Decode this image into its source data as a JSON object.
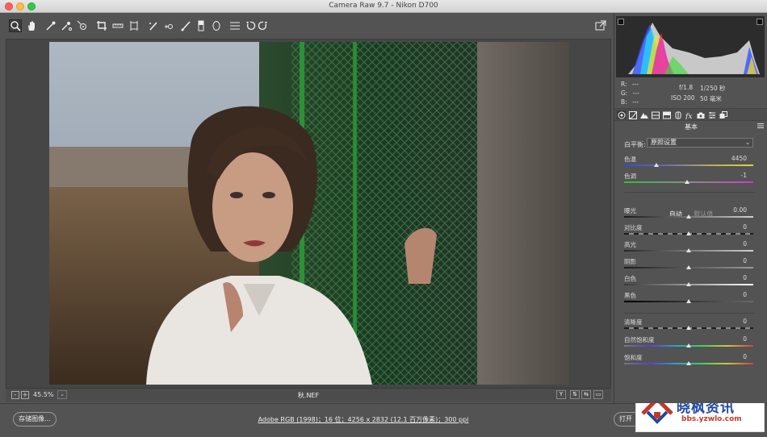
{
  "window": {
    "title": "Camera Raw 9.7 -  Nikon D700"
  },
  "toolbar": {
    "tools": [
      {
        "name": "zoom-tool",
        "icon": "zoom-icon"
      },
      {
        "name": "hand-tool",
        "icon": "hand-icon"
      },
      {
        "name": "white-balance-tool",
        "icon": "eyedropper-icon"
      },
      {
        "name": "color-sampler-tool",
        "icon": "color-sampler-icon"
      },
      {
        "name": "targeted-adjustment-tool",
        "icon": "target-adjust-icon"
      },
      {
        "name": "crop-tool",
        "icon": "crop-icon"
      },
      {
        "name": "straighten-tool",
        "icon": "straighten-icon"
      },
      {
        "name": "transform-tool",
        "icon": "transform-icon"
      },
      {
        "name": "spot-removal-tool",
        "icon": "spot-removal-icon"
      },
      {
        "name": "red-eye-tool",
        "icon": "red-eye-icon"
      },
      {
        "name": "adjustment-brush-tool",
        "icon": "brush-icon"
      },
      {
        "name": "graduated-filter-tool",
        "icon": "graduated-filter-icon"
      },
      {
        "name": "radial-filter-tool",
        "icon": "radial-filter-icon"
      },
      {
        "name": "preferences-tool",
        "icon": "list-icon"
      },
      {
        "name": "rotate-ccw-tool",
        "icon": "rotate-ccw-icon"
      },
      {
        "name": "rotate-cw-tool",
        "icon": "rotate-cw-icon"
      }
    ],
    "fullscreen_icon": "fullscreen-icon"
  },
  "status": {
    "zoom_minus": "-",
    "zoom_plus": "+",
    "zoom_level": "45.5%",
    "zoom_dropdown": "⌄",
    "filename": "秋.NEF",
    "view_y": "Y"
  },
  "bottom": {
    "save_label": "存储图像...",
    "workflow_text": "Adobe RGB (1998)；16 位；4256 x 2832 (12.1 百万像素)；300 ppi",
    "open_label": "打开"
  },
  "watermark": {
    "title": "晓枫资讯",
    "url": "bbs.yzwlo.com"
  },
  "readout": {
    "r_label": "R:",
    "r_val": "---",
    "g_label": "G:",
    "g_val": "---",
    "b_label": "B:",
    "b_val": "---",
    "aperture": "f/1.8",
    "shutter": "1/250 秒",
    "iso": "ISO 200",
    "focal": "50 毫米"
  },
  "panel": {
    "section_title": "基本",
    "wb_label": "白平衡:",
    "wb_value": "原照设置",
    "temp_label": "色温",
    "temp_value": "4450",
    "temp_level": 0.25,
    "tint_label": "色调",
    "tint_value": "-1",
    "tint_level": 0.49,
    "auto_label": "自动",
    "default_label": "默认值",
    "exposure_label": "曝光",
    "exposure_value": "0.00",
    "contrast_label": "对比度",
    "contrast_value": "0",
    "highlights_label": "高光",
    "highlights_value": "0",
    "shadows_label": "阴影",
    "shadows_value": "0",
    "whites_label": "白色",
    "whites_value": "0",
    "blacks_label": "黑色",
    "blacks_value": "0",
    "clarity_label": "清晰度",
    "clarity_value": "0",
    "vibrance_label": "自然饱和度",
    "vibrance_value": "0",
    "saturation_label": "饱和度",
    "saturation_value": "0"
  },
  "colors": {
    "panel_bg": "#535353",
    "temp_gradient_start": "#2b4cd9",
    "temp_gradient_end": "#e0d23a",
    "tint_gradient_start": "#2fbf3a",
    "tint_gradient_end": "#cc3bd1"
  }
}
